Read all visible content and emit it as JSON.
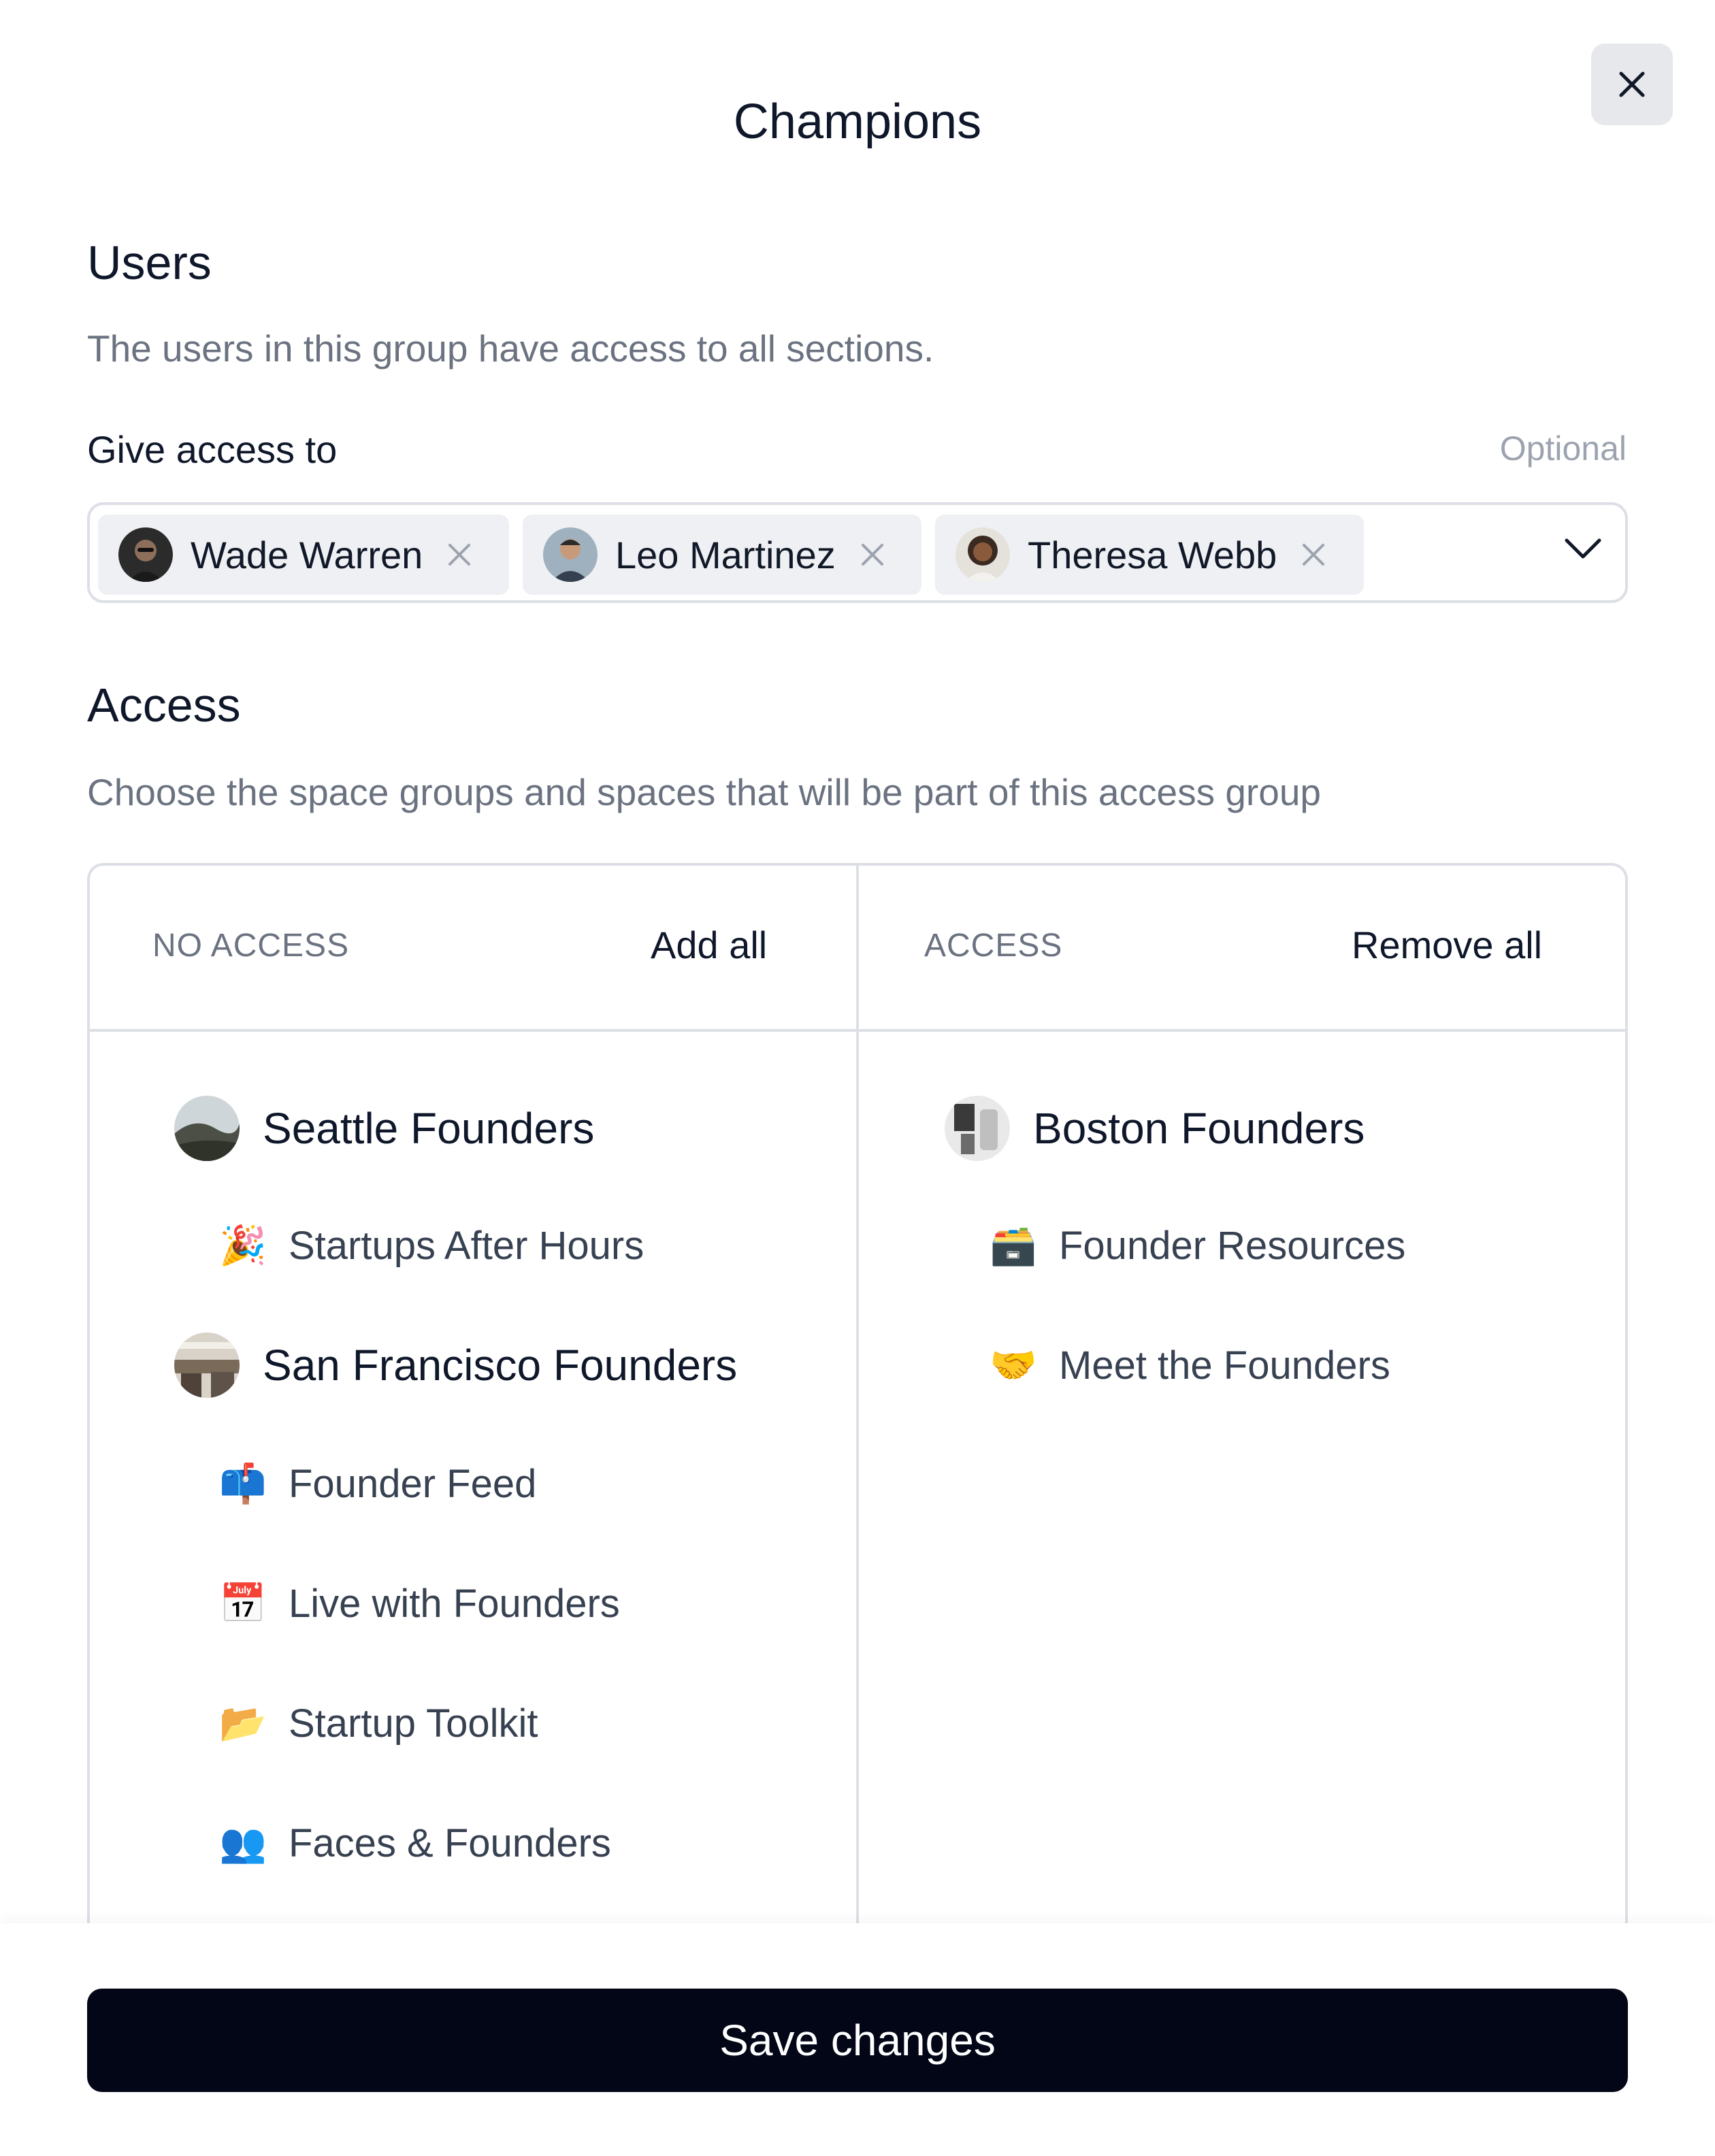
{
  "modal": {
    "title": "Champions",
    "close_icon": "close-icon"
  },
  "users": {
    "heading": "Users",
    "description": "The users in this group have access to all sections.",
    "field_label": "Give access to",
    "optional_label": "Optional",
    "selected": [
      {
        "name": "Wade Warren"
      },
      {
        "name": "Leo Martinez"
      },
      {
        "name": "Theresa Webb"
      }
    ]
  },
  "access": {
    "heading": "Access",
    "description": "Choose the space groups and spaces that will be part of this access group",
    "no_access": {
      "header": "NO ACCESS",
      "action": "Add all",
      "groups": [
        {
          "name": "Seattle Founders",
          "spaces": [
            {
              "icon": "🎉",
              "name": "Startups After Hours"
            }
          ]
        },
        {
          "name": "San Francisco Founders",
          "spaces": [
            {
              "icon": "📫",
              "name": "Founder Feed"
            },
            {
              "icon": "📅",
              "name": "Live with Founders"
            },
            {
              "icon": "📂",
              "name": "Startup Toolkit"
            },
            {
              "icon": "👥",
              "name": "Faces & Founders"
            }
          ]
        }
      ]
    },
    "with_access": {
      "header": "ACCESS",
      "action": "Remove all",
      "groups": [
        {
          "name": "Boston Founders",
          "spaces": [
            {
              "icon": "🗃️",
              "name": "Founder Resources"
            },
            {
              "icon": "🤝",
              "name": "Meet the Founders"
            }
          ]
        }
      ]
    }
  },
  "footer": {
    "save_label": "Save changes"
  }
}
